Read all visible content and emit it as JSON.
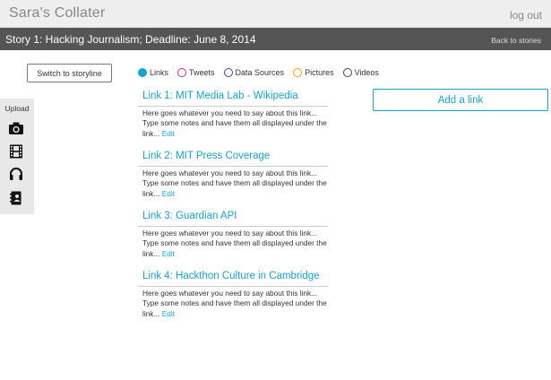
{
  "app": {
    "title": "Sara's Collater",
    "logout_label": "log out"
  },
  "story": {
    "title": "Story 1: Hacking Journalism; Deadline: June 8, 2014",
    "back_label": "Back to stories"
  },
  "switch_label": "Switch to storyline",
  "filters": [
    {
      "label": "Links",
      "selected": true,
      "color": "#1aa3c9"
    },
    {
      "label": "Tweets",
      "selected": false,
      "color": "#d6336c"
    },
    {
      "label": "Data Sources",
      "selected": false,
      "color": "#4b3f9e"
    },
    {
      "label": "Pictures",
      "selected": false,
      "color": "#e8a317"
    },
    {
      "label": "Videos",
      "selected": false,
      "color": "#444444"
    }
  ],
  "upload": {
    "label": "Upload",
    "icons": [
      "camera-icon",
      "film-icon",
      "headphones-icon",
      "contact-card-icon"
    ]
  },
  "links": [
    {
      "title": "Link 1: MIT Media Lab - Wikipedia",
      "note": "Here goes whatever you need to say about this link... Type some notes and have them all displayed under the link...",
      "edit": "Edit"
    },
    {
      "title": "Link 2: MIT Press Coverage",
      "note": "Here goes whatever you need to say about this link... Type some notes and have them all displayed under the link...",
      "edit": "Edit"
    },
    {
      "title": "Link 3: Guardian API",
      "note": "Here goes whatever you need to say about this link... Type some notes and have them all displayed under the link...",
      "edit": "Edit"
    },
    {
      "title": "Link 4: Hackthon Culture in Cambridge",
      "note": "Here goes whatever you need to say about this link... Type some notes and have them all displayed under the link...",
      "edit": "Edit"
    }
  ],
  "add_link_label": "Add a link",
  "colors": {
    "accent": "#1aa3c9",
    "storybar": "#555555",
    "topbar": "#eeeeee"
  }
}
